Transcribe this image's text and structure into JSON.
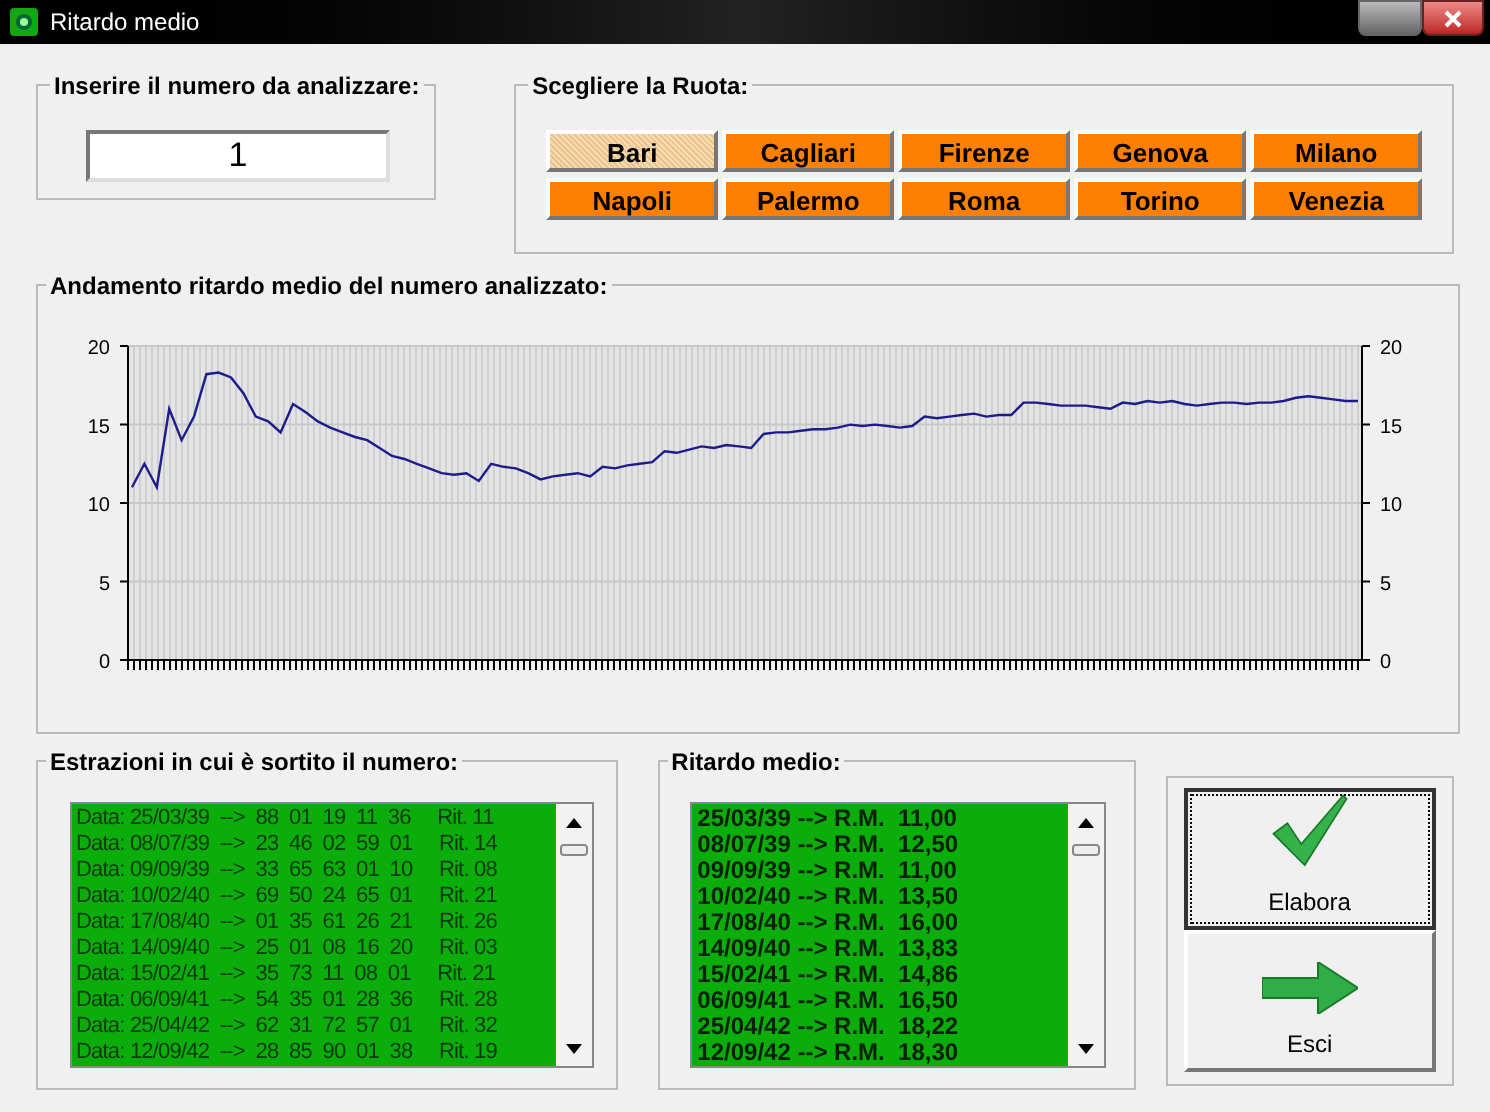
{
  "window": {
    "title": "Ritardo medio"
  },
  "number_group": {
    "label": "Inserire il numero da analizzare:",
    "value": "1"
  },
  "wheel_group": {
    "label": "Scegliere la Ruota:",
    "wheels": [
      {
        "label": "Bari",
        "selected": true
      },
      {
        "label": "Cagliari",
        "selected": false
      },
      {
        "label": "Firenze",
        "selected": false
      },
      {
        "label": "Genova",
        "selected": false
      },
      {
        "label": "Milano",
        "selected": false
      },
      {
        "label": "Napoli",
        "selected": false
      },
      {
        "label": "Palermo",
        "selected": false
      },
      {
        "label": "Roma",
        "selected": false
      },
      {
        "label": "Torino",
        "selected": false
      },
      {
        "label": "Venezia",
        "selected": false
      }
    ]
  },
  "chart_group": {
    "chart_data": {
      "type": "line",
      "title": "Andamento ritardo medio del numero analizzato:",
      "ylim": [
        0,
        20
      ],
      "yticks": [
        0,
        5,
        10,
        15,
        20
      ],
      "y2ticks": [
        0,
        5,
        10,
        15,
        20
      ],
      "y2lim": [
        0,
        20
      ],
      "grid": true,
      "series": [
        {
          "color": "#1c1c8c",
          "values": [
            11,
            12.5,
            11,
            16,
            14,
            15.5,
            18.2,
            18.3,
            18,
            17,
            15.5,
            15.2,
            14.5,
            16.3,
            15.8,
            15.2,
            14.8,
            14.5,
            14.2,
            14,
            13.5,
            13,
            12.8,
            12.5,
            12.2,
            11.9,
            11.8,
            11.9,
            11.4,
            12.5,
            12.3,
            12.2,
            11.9,
            11.5,
            11.7,
            11.8,
            11.9,
            11.7,
            12.3,
            12.2,
            12.4,
            12.5,
            12.6,
            13.3,
            13.2,
            13.4,
            13.6,
            13.5,
            13.7,
            13.6,
            13.5,
            14.4,
            14.5,
            14.5,
            14.6,
            14.7,
            14.7,
            14.8,
            15,
            14.9,
            15,
            14.9,
            14.8,
            14.9,
            15.5,
            15.4,
            15.5,
            15.6,
            15.7,
            15.5,
            15.6,
            15.6,
            16.4,
            16.4,
            16.3,
            16.2,
            16.2,
            16.2,
            16.1,
            16,
            16.4,
            16.3,
            16.5,
            16.4,
            16.5,
            16.3,
            16.2,
            16.3,
            16.4,
            16.4,
            16.3,
            16.4,
            16.4,
            16.5,
            16.7,
            16.8,
            16.7,
            16.6,
            16.5,
            16.5
          ]
        }
      ]
    }
  },
  "draws_group": {
    "label": "Estrazioni in cui è sortito il numero:",
    "rows": [
      "Data: 25/03/39  -->  88  01  19  11  36     Rit. 11",
      "Data: 08/07/39  -->  23  46  02  59  01     Rit. 14",
      "Data: 09/09/39  -->  33  65  63  01  10     Rit. 08",
      "Data: 10/02/40  -->  69  50  24  65  01     Rit. 21",
      "Data: 17/08/40  -->  01  35  61  26  21     Rit. 26",
      "Data: 14/09/40  -->  25  01  08  16  20     Rit. 03",
      "Data: 15/02/41  -->  35  73  11  08  01     Rit. 21",
      "Data: 06/09/41  -->  54  35  01  28  36     Rit. 28",
      "Data: 25/04/42  -->  62  31  72  57  01     Rit. 32",
      "Data: 12/09/42  -->  28  85  90  01  38     Rit. 19"
    ]
  },
  "average_group": {
    "label": "Ritardo medio:",
    "rows": [
      "25/03/39 --> R.M.  11,00",
      "08/07/39 --> R.M.  12,50",
      "09/09/39 --> R.M.  11,00",
      "10/02/40 --> R.M.  13,50",
      "17/08/40 --> R.M.  16,00",
      "14/09/40 --> R.M.  13,83",
      "15/02/41 --> R.M.  14,86",
      "06/09/41 --> R.M.  16,50",
      "25/04/42 --> R.M.  18,22",
      "12/09/42 --> R.M.  18,30"
    ]
  },
  "buttons": [
    {
      "kind": "process",
      "label": "Elabora"
    },
    {
      "kind": "exit",
      "label": "Esci"
    }
  ]
}
